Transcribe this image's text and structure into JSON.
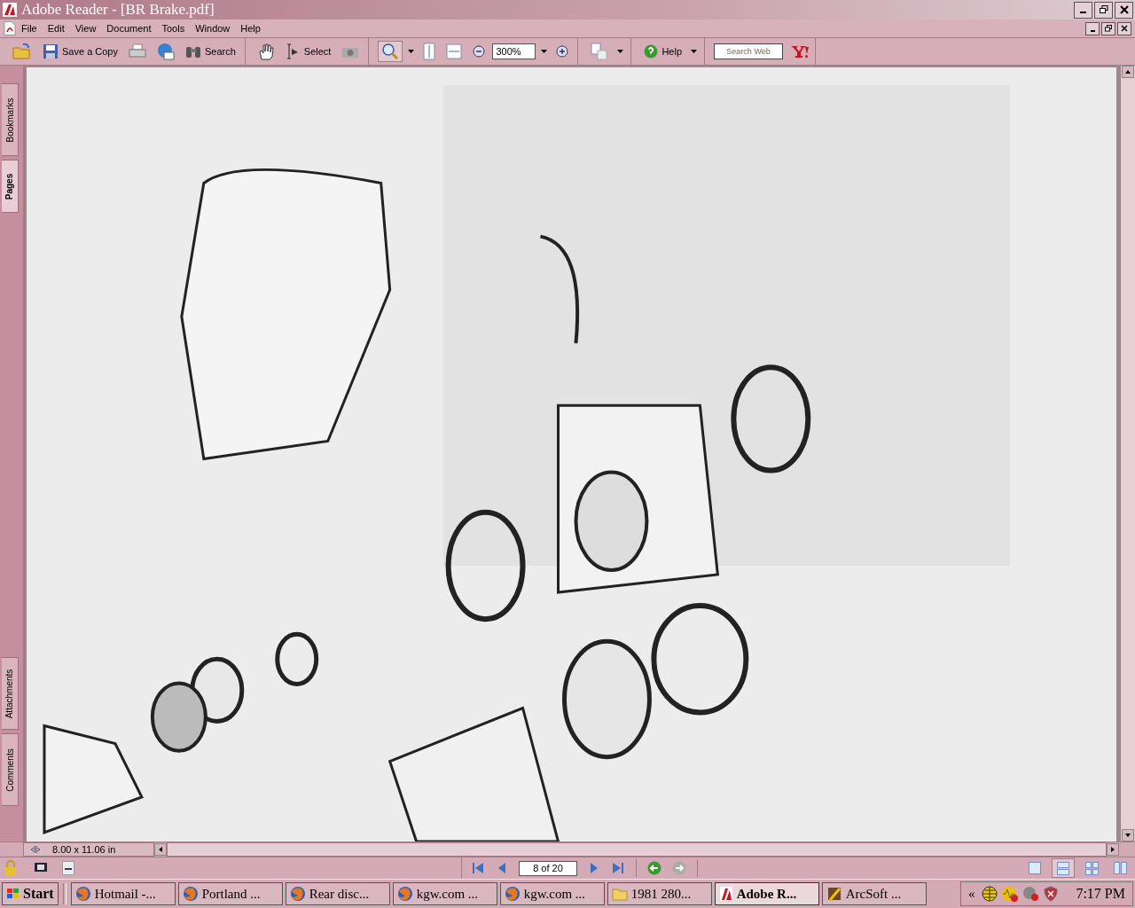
{
  "window": {
    "title": "Adobe Reader - [BR Brake.pdf]"
  },
  "menu": [
    "File",
    "Edit",
    "View",
    "Document",
    "Tools",
    "Window",
    "Help"
  ],
  "toolbar": {
    "save_label": "Save a Copy",
    "search_label": "Search",
    "select_label": "Select",
    "zoom": "300%",
    "help_label": "Help",
    "web_search": {
      "placeholder": "Search Web"
    }
  },
  "side_tabs_top": [
    {
      "label": "Bookmarks",
      "selected": false
    },
    {
      "label": "Pages",
      "selected": true
    }
  ],
  "side_tabs_bottom": [
    {
      "label": "Attachments",
      "selected": false
    },
    {
      "label": "Comments",
      "selected": false
    }
  ],
  "document": {
    "kind": "picture"
  },
  "page_size": "8.00 x 11.06 in",
  "navigation": {
    "page": "8 of 20"
  },
  "layout_modes": [
    {
      "selected": false
    },
    {
      "selected": true
    },
    {
      "selected": false
    },
    {
      "selected": false
    }
  ],
  "taskbar": {
    "start": "Start",
    "tasks": [
      {
        "label": "Hotmail -...",
        "kind": "browser",
        "selected": false
      },
      {
        "label": "Portland ...",
        "kind": "browser",
        "selected": false
      },
      {
        "label": "Rear disc...",
        "kind": "browser",
        "selected": false
      },
      {
        "label": "kgw.com ...",
        "kind": "browser",
        "selected": false
      },
      {
        "label": "kgw.com ...",
        "kind": "browser",
        "selected": false
      },
      {
        "label": "1981 280...",
        "kind": "folder",
        "selected": false
      },
      {
        "label": "Adobe R...",
        "kind": "reader",
        "selected": true
      },
      {
        "label": "ArcSoft ...",
        "kind": "editor",
        "selected": false
      }
    ],
    "tray_toggle": "«",
    "clock": "7:17 PM"
  }
}
